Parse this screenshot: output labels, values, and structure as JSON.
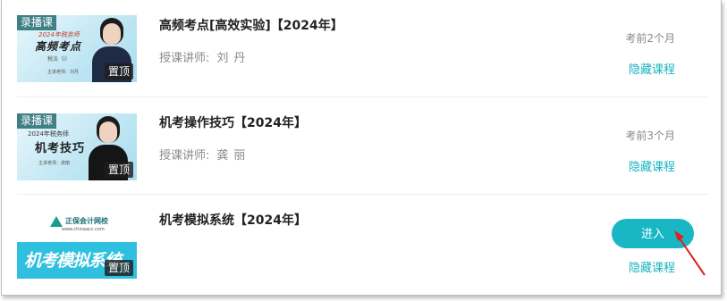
{
  "courses": [
    {
      "thumb_tag": "录播课",
      "thumb_sub": "2024年税务师",
      "thumb_big": "高频考点",
      "thumb_small": "税法（I）",
      "thumb_teacher": "主讲老师：刘丹",
      "pin": "置顶",
      "title": "高频考点[高效实验]【2024年】",
      "teacher_label": "授课讲师:",
      "teacher_name": "刘丹",
      "exam_info": "考前2个月",
      "hide_label": "隐藏课程"
    },
    {
      "thumb_tag": "录播课",
      "thumb_sub": "2024年税务师",
      "thumb_big": "机考技巧",
      "thumb_small": "主讲老师：龚丽",
      "pin": "置顶",
      "title": "机考操作技巧【2024年】",
      "teacher_label": "授课讲师:",
      "teacher_name": "龚丽",
      "exam_info": "考前3个月",
      "hide_label": "隐藏课程"
    },
    {
      "thumb_brand": "正保会计网校",
      "thumb_url": "www.chinaacc.com",
      "thumb_big": "机考模拟系统",
      "pin": "置顶",
      "title": "机考模拟系统【2024年】",
      "enter_label": "进入",
      "hide_label": "隐藏课程"
    }
  ],
  "colors": {
    "accent": "#19b7c4",
    "link": "#17b3c0",
    "annotation_arrow": "#e02020"
  }
}
